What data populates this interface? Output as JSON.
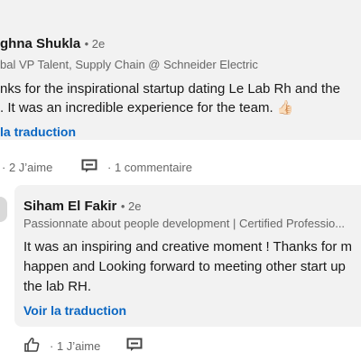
{
  "comment": {
    "author": "ghna Shukla",
    "degree": "• 2e",
    "headline": "bal VP Talent, Supply Chain @ Schneider Electric",
    "body_lines": [
      "nks for the inspirational startup dating Le Lab Rh and the",
      ". It was an incredible experience for the team. 👍🏻"
    ],
    "translate_label": "la traduction",
    "likes_label": "· 2 J’aime",
    "comments_label": "· 1 commentaire"
  },
  "reply": {
    "author": "Siham El Fakir",
    "degree": "• 2e",
    "headline": "Passionnate about people development | Certified Professio...",
    "body_lines": [
      "It was an inspiring and creative moment ! Thanks for m",
      "happen and Looking forward to meeting other start up",
      "the lab RH."
    ],
    "translate_label": "Voir la traduction",
    "likes_label": "· 1 J’aime"
  },
  "icons": {
    "thumbs_up": "thumbs-up-icon",
    "reply": "reply-icon"
  },
  "colors": {
    "card_bg": "#f2f2f2",
    "link_blue": "#0a66c2",
    "muted_text": "#666666",
    "text": "#191919"
  }
}
